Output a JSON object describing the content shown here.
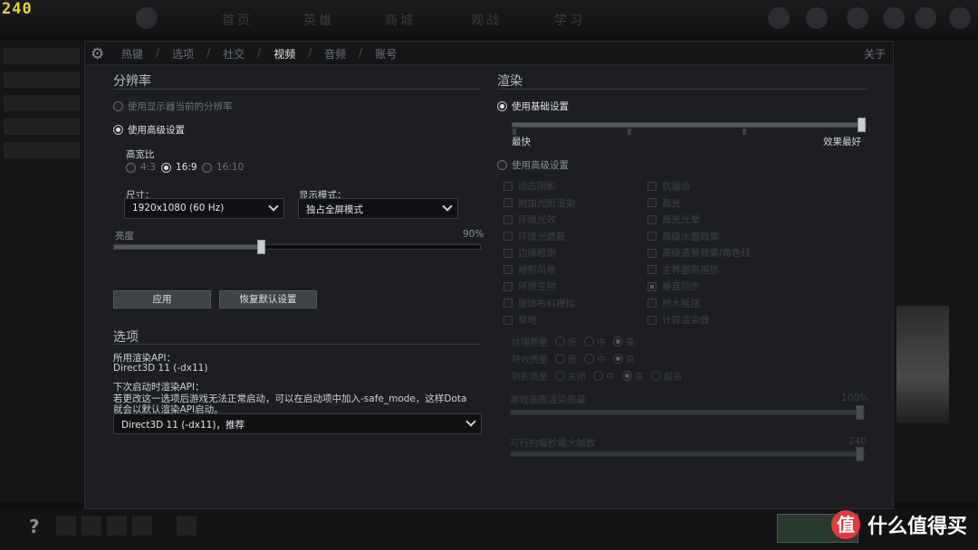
{
  "fps": "240",
  "background": {
    "tabs": [
      "首页",
      "英雄",
      "商城",
      "观战",
      "学习"
    ]
  },
  "watermark": {
    "logo": "值",
    "text": "什么值得买"
  },
  "topbar": {
    "tabs": [
      {
        "label": "热键",
        "active": false
      },
      {
        "label": "选项",
        "active": false
      },
      {
        "label": "社交",
        "active": false
      },
      {
        "label": "视频",
        "active": true
      },
      {
        "label": "音频",
        "active": false
      },
      {
        "label": "账号",
        "active": false
      }
    ],
    "about": "关于"
  },
  "resolution": {
    "title": "分辨率",
    "use_monitor": "使用显示器当前的分辨率",
    "use_advanced": "使用高级设置",
    "aspect_label": "高宽比",
    "aspects": [
      {
        "label": "4:3",
        "selected": false
      },
      {
        "label": "16:9",
        "selected": true
      },
      {
        "label": "16:10",
        "selected": false
      }
    ],
    "size_label": "尺寸：",
    "size_value": "1920x1080 (60 Hz)",
    "display_mode_label": "显示模式：",
    "display_mode_value": "独占全屏模式",
    "brightness_label": "亮度",
    "brightness_value": "90%",
    "brightness_level": 0.4,
    "apply": "应用",
    "restore": "恢复默认设置"
  },
  "options": {
    "title": "选项",
    "api_label": "所用渲染API：",
    "api_value": "Direct3D 11 (-dx11)",
    "next_label": "下次启动时渲染API：",
    "next_note_1": "若更改这一选项后游戏无法正常启动，可以在启动项中加入-safe_mode，这样Dota",
    "next_note_2": "就会以默认渲染API启动。",
    "next_value": "Direct3D 11 (-dx11)，推荐"
  },
  "render": {
    "title": "渲染",
    "basic": "使用基础设置",
    "fast": "最快",
    "best": "效果最好",
    "quality_level": 1.0,
    "advanced": "使用高级设置",
    "checks_left": [
      {
        "label": "动态阴影",
        "checked": false
      },
      {
        "label": "附加光照渲染",
        "checked": false
      },
      {
        "label": "环境光效",
        "checked": false
      },
      {
        "label": "环境光遮蔽",
        "checked": false
      },
      {
        "label": "边缘检测",
        "checked": false
      },
      {
        "label": "地形风景",
        "checked": false
      },
      {
        "label": "环境生物",
        "checked": false
      },
      {
        "label": "服饰布料模拟",
        "checked": false
      },
      {
        "label": "草地",
        "checked": false
      }
    ],
    "checks_right": [
      {
        "label": "抗锯齿",
        "checked": false
      },
      {
        "label": "高光",
        "checked": false
      },
      {
        "label": "高光光晕",
        "checked": false
      },
      {
        "label": "高级水面效果",
        "checked": false
      },
      {
        "label": "高级造景效果/角色线",
        "checked": false
      },
      {
        "label": "主界面高画质",
        "checked": false
      },
      {
        "label": "垂直同步",
        "checked": true
      },
      {
        "label": "树木摇摆",
        "checked": false
      },
      {
        "label": "计算渲染器",
        "checked": false
      }
    ],
    "texture": {
      "label": "纹理质量",
      "options": [
        "低",
        "中",
        "高"
      ],
      "selected": 2
    },
    "effects": {
      "label": "特效质量",
      "options": [
        "低",
        "中",
        "高"
      ],
      "selected": 2
    },
    "shadow": {
      "label": "阴影质量",
      "options": [
        "关闭",
        "中",
        "高",
        "超高"
      ],
      "selected": 2
    },
    "render_quality_label": "游戏画面渲染质量",
    "render_quality_value": "100%",
    "render_quality_level": 1.0,
    "max_fps_label": "可行的每秒最大帧数",
    "max_fps_value": "240",
    "max_fps_level": 1.0
  }
}
